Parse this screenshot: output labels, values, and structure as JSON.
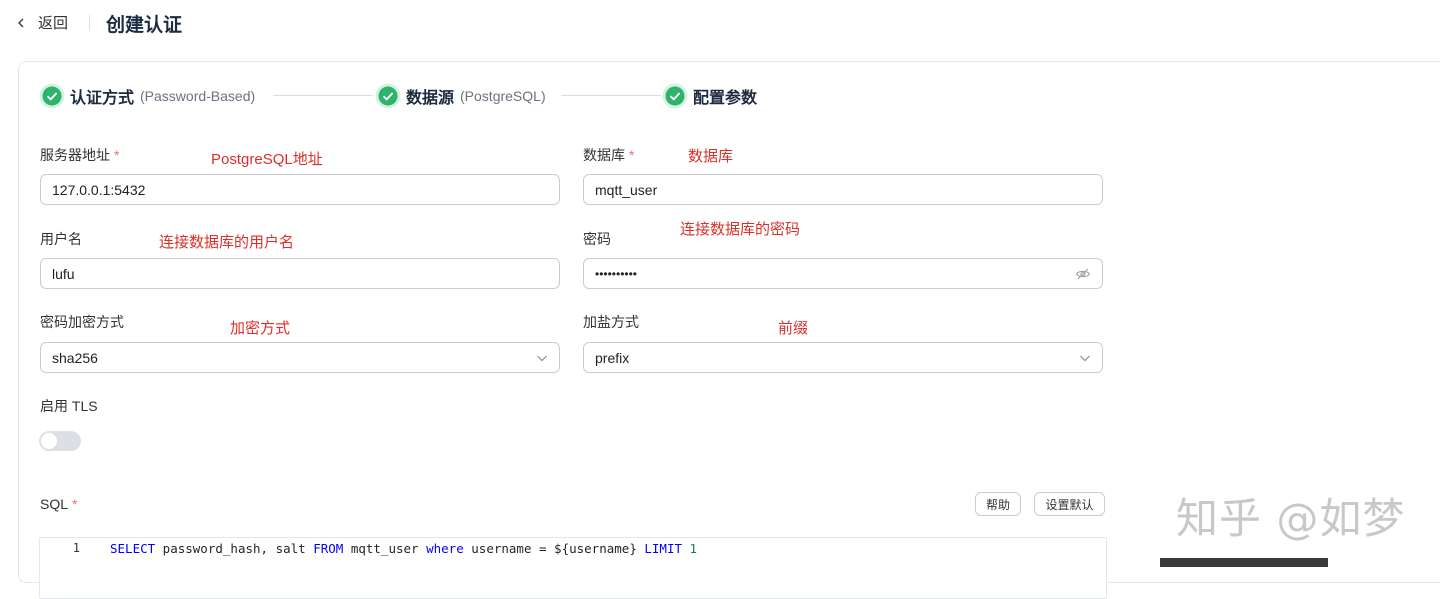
{
  "header": {
    "back_label": "返回",
    "title": "创建认证"
  },
  "steps": [
    {
      "title": "认证方式",
      "sub": "(Password-Based)"
    },
    {
      "title": "数据源",
      "sub": "(PostgreSQL)"
    },
    {
      "title": "配置参数",
      "sub": ""
    }
  ],
  "form": {
    "server": {
      "label": "服务器地址",
      "required": "*",
      "value": "127.0.0.1:5432",
      "note": "PostgreSQL地址"
    },
    "database": {
      "label": "数据库",
      "required": "*",
      "value": "mqtt_user",
      "note": "数据库"
    },
    "username": {
      "label": "用户名",
      "value": "lufu",
      "note": "连接数据库的用户名"
    },
    "password": {
      "label": "密码",
      "value": "••••••••••",
      "note": "连接数据库的密码"
    },
    "hash": {
      "label": "密码加密方式",
      "value": "sha256",
      "note": "加密方式"
    },
    "salt": {
      "label": "加盐方式",
      "value": "prefix",
      "note": "前缀"
    },
    "tls": {
      "label": "启用 TLS",
      "enabled": false
    }
  },
  "sql": {
    "label": "SQL",
    "required": "*",
    "help_label": "帮助",
    "default_label": "设置默认",
    "line_number": "1",
    "tokens": [
      {
        "t": "SELECT",
        "c": "kw"
      },
      {
        "t": " password_hash, salt ",
        "c": ""
      },
      {
        "t": "FROM",
        "c": "kw"
      },
      {
        "t": " mqtt_user ",
        "c": ""
      },
      {
        "t": "where",
        "c": "kw"
      },
      {
        "t": " username = ${username} ",
        "c": ""
      },
      {
        "t": "LIMIT",
        "c": "kw"
      },
      {
        "t": " ",
        "c": ""
      },
      {
        "t": "1",
        "c": "num"
      }
    ]
  },
  "watermark": "知乎 @如梦",
  "colors": {
    "success": "#2fb26a",
    "required": "#f56c6c",
    "note": "#d9302a",
    "title": "#1c2b40"
  }
}
